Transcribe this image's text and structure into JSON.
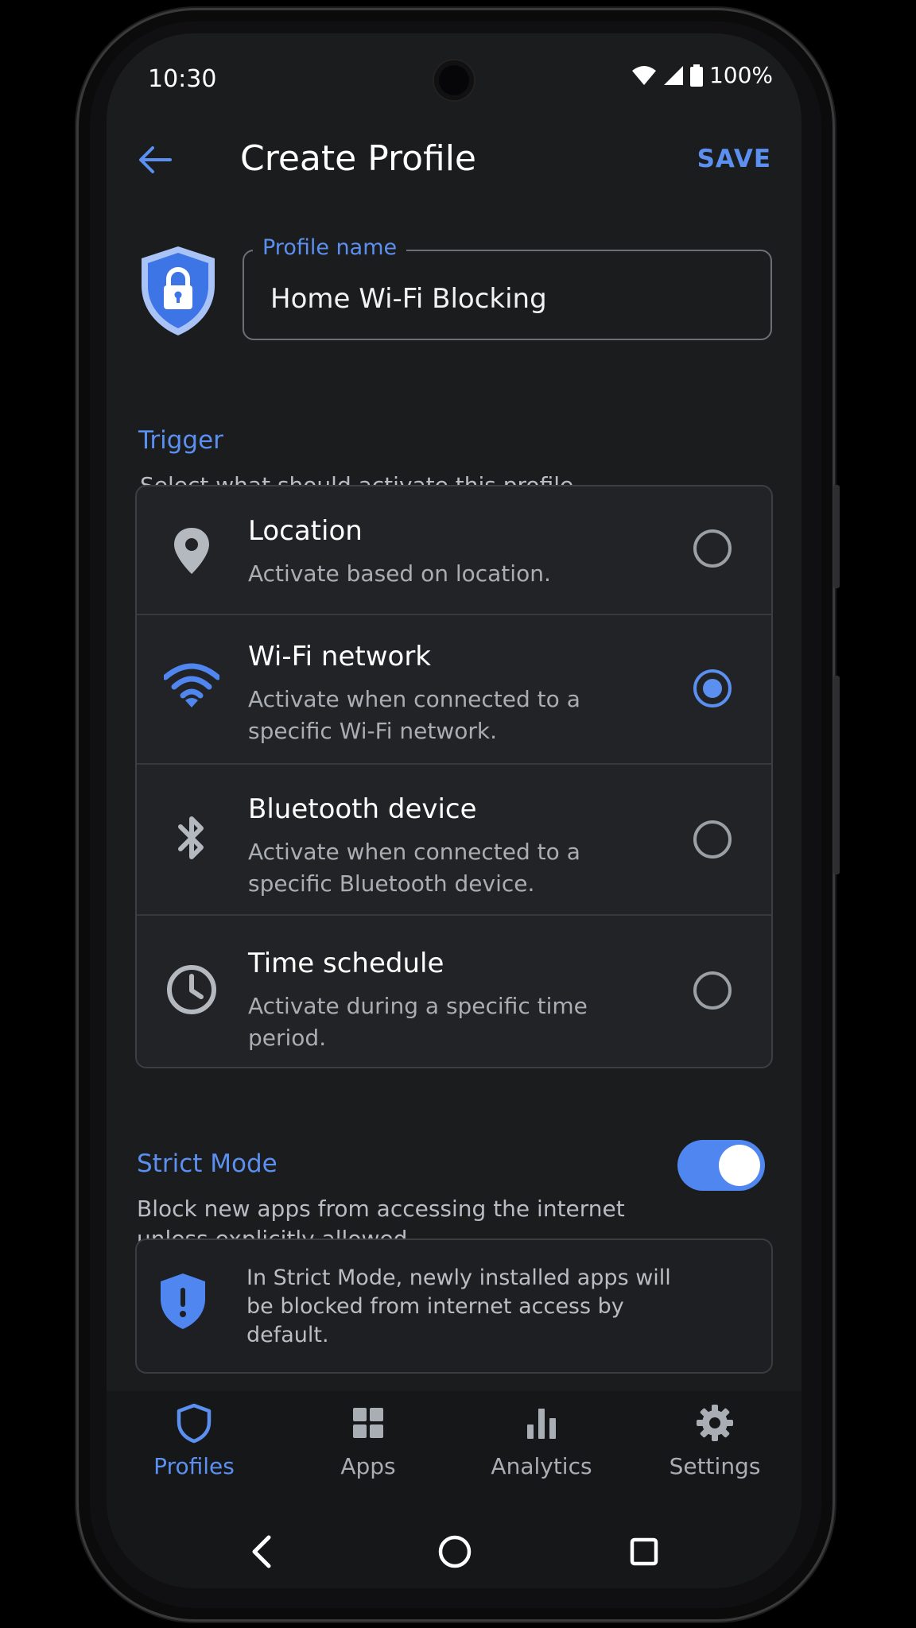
{
  "status": {
    "time": "10:30",
    "battery": "100%"
  },
  "appbar": {
    "title": "Create Profile",
    "save_label": "SAVE"
  },
  "profile_field": {
    "label": "Profile name",
    "value": "Home Wi-Fi Blocking"
  },
  "trigger": {
    "title": "Trigger",
    "description": "Select what should activate this profile.",
    "options": [
      {
        "title": "Location",
        "subtitle": "Activate based on location.",
        "icon": "location-pin-icon",
        "selected": false
      },
      {
        "title": "Wi-Fi network",
        "subtitle": "Activate when connected to a specific Wi-Fi network.",
        "icon": "wifi-icon",
        "selected": true
      },
      {
        "title": "Bluetooth device",
        "subtitle": "Activate when connected to a specific Bluetooth device.",
        "icon": "bluetooth-icon",
        "selected": false
      },
      {
        "title": "Time schedule",
        "subtitle": "Activate during a specific time period.",
        "icon": "clock-icon",
        "selected": false
      }
    ]
  },
  "strict_mode": {
    "title": "Strict Mode",
    "description": "Block new apps from accessing the internet unless explicitly allowed.",
    "enabled": true,
    "info": "In Strict Mode, newly installed apps will be blocked from internet access by default."
  },
  "bottom_nav": [
    {
      "label": "Profiles",
      "icon": "shield-icon",
      "active": true
    },
    {
      "label": "Apps",
      "icon": "grid-icon",
      "active": false
    },
    {
      "label": "Analytics",
      "icon": "bar-chart-icon",
      "active": false
    },
    {
      "label": "Settings",
      "icon": "gear-icon",
      "active": false
    }
  ],
  "colors": {
    "accent": "#5b8ff0",
    "background": "#1b1c1e",
    "surface": "#222326"
  }
}
